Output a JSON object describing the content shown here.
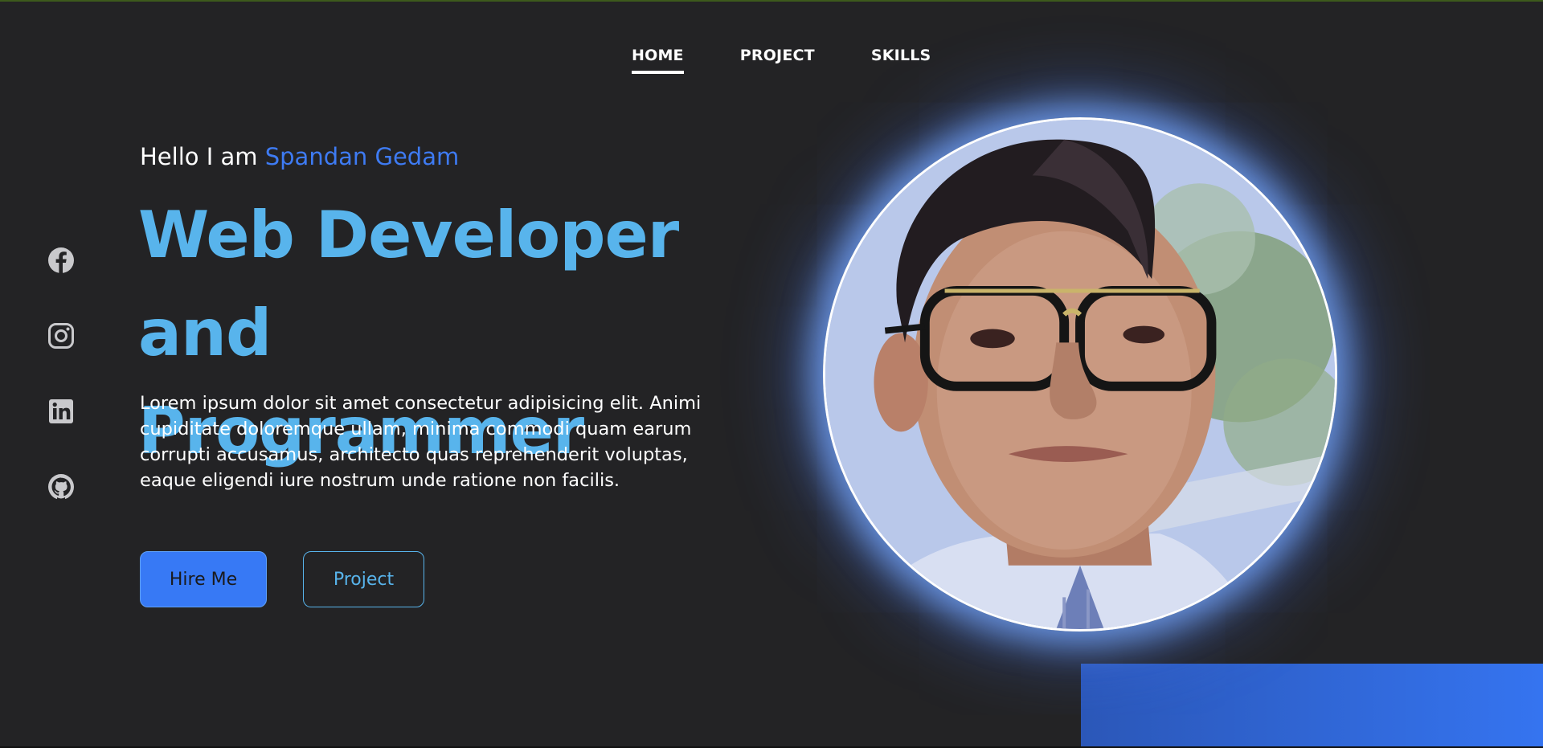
{
  "nav": {
    "items": [
      {
        "label": "HOME",
        "active": true
      },
      {
        "label": "PROJECT",
        "active": false
      },
      {
        "label": "SKILLS",
        "active": false
      }
    ]
  },
  "social": [
    {
      "icon": "facebook-icon"
    },
    {
      "icon": "instagram-icon"
    },
    {
      "icon": "linkedin-icon"
    },
    {
      "icon": "github-icon"
    }
  ],
  "hero": {
    "greeting_prefix": "Hello I am ",
    "name": "Spandan Gedam",
    "headline_line1": "Web Developer and",
    "headline_line2": "Programmer",
    "description": "Lorem ipsum dolor sit amet consectetur adipisicing elit. Animi cupiditate doloremque ullam, minima commodi quam earum corrupti accusamus, architecto quas reprehenderit voluptas, eaque eligendi iure nostrum unde ratione non facilis.",
    "hire_button": "Hire Me",
    "project_button": "Project"
  },
  "colors": {
    "background": "#232325",
    "accent_blue": "#3779f5",
    "headline_blue": "#58b4ec",
    "name_blue": "#3e7bf3",
    "icon_gray": "#c9c9cc"
  }
}
